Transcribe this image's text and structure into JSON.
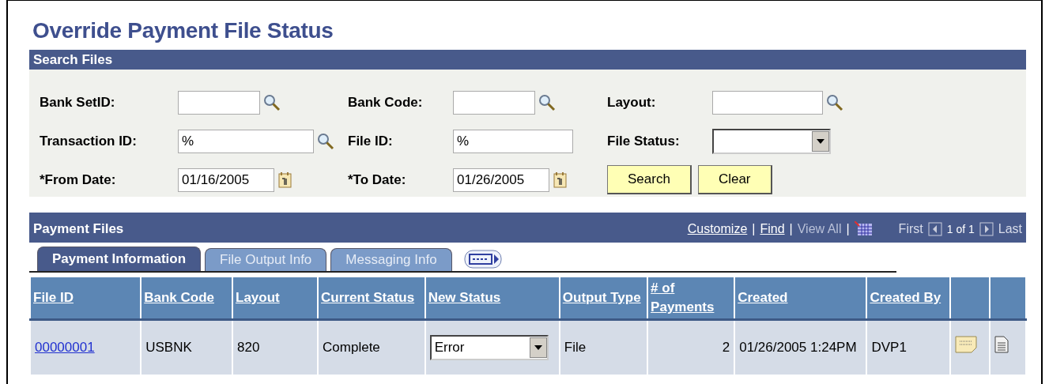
{
  "page_title": "Override Payment File Status",
  "search_files": {
    "title": "Search Files",
    "fields": [
      {
        "label": "Bank SetID:",
        "kind": "lookup"
      },
      {
        "label": "Bank Code:",
        "kind": "lookup"
      },
      {
        "label": "Layout:",
        "kind": "lookup"
      },
      {
        "label": "Transaction ID:",
        "value": "%",
        "kind": "lookup"
      },
      {
        "label": "File ID:",
        "value": "%",
        "kind": "text"
      },
      {
        "label": "File Status:",
        "kind": "select"
      },
      {
        "label": "*From Date:",
        "value": "01/16/2005",
        "kind": "date"
      },
      {
        "label": "*To Date:",
        "value": "01/26/2005",
        "kind": "date"
      }
    ],
    "buttons": [
      "Search",
      "Clear"
    ]
  },
  "payment_files": {
    "title": "Payment Files",
    "links": [
      {
        "label": "Customize",
        "disabled": false,
        "separator": "|"
      },
      {
        "label": "Find",
        "disabled": false,
        "separator": "|"
      },
      {
        "label": "View All",
        "disabled": true,
        "separator": "|"
      }
    ],
    "pager": {
      "first": "First",
      "count": "1 of 1",
      "last": "Last"
    },
    "tabs": [
      {
        "label": "Payment Information",
        "selected": true
      },
      {
        "label": "File Output Info",
        "selected": false
      },
      {
        "label": "Messaging Info",
        "selected": false
      }
    ],
    "columns": [
      "File ID",
      "Bank Code",
      "Layout",
      "Current Status",
      "New Status",
      "Output Type",
      "# of Payments",
      "Created",
      "Created By"
    ],
    "rows": [
      {
        "file_id": "00000001",
        "bank_code": "USBNK",
        "layout": "820",
        "current_status": "Complete",
        "new_status": "Error",
        "output_type": "File",
        "payments": "2",
        "created": "01/26/2005 1:24PM",
        "created_by": "DVP1"
      }
    ]
  }
}
